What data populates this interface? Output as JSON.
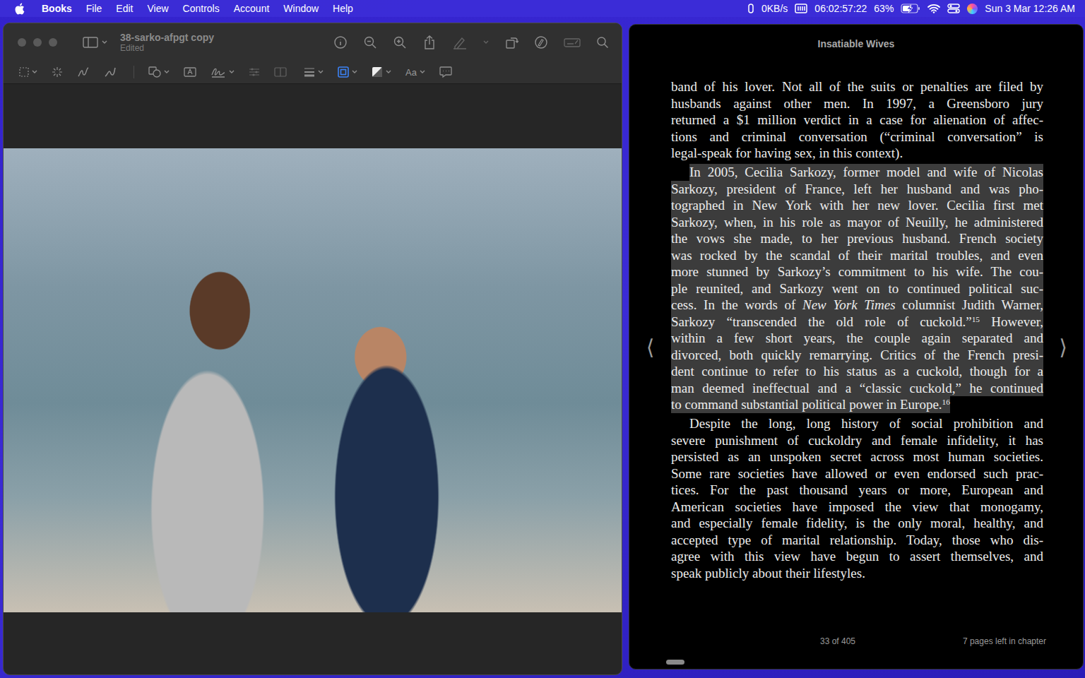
{
  "menubar": {
    "app_menu": "Books",
    "menus": [
      "File",
      "Edit",
      "View",
      "Controls",
      "Account",
      "Window",
      "Help"
    ],
    "status": {
      "network": "0KB/s",
      "timer": "06:02:57:22",
      "battery": "63%",
      "battery_level": 0.63,
      "charging": true,
      "clock": "Sun 3 Mar 12:26 AM"
    }
  },
  "preview": {
    "title": "38-sarko-afpgt copy",
    "subtitle": "Edited",
    "font_button": "Aa"
  },
  "books": {
    "title": "Insatiable Wives",
    "paragraphs": [
      {
        "highlighted": false,
        "lines": [
          "band of his lover. Not all of the suits or penalties are filed by",
          "husbands against other men. In 1997, a Greensboro jury",
          "returned a $1 million verdict in a case for alienation of affec-",
          "tions and criminal conversation (“criminal conversation” is",
          "legal-speak for having sex, in this context)."
        ]
      },
      {
        "highlighted": true,
        "lines": [
          "In 2005, Cecilia Sarkozy, former model and wife of Nicolas",
          "Sarkozy, president of France, left her husband and was pho-",
          "tographed in New York with her new lover. Cecilia first met",
          "Sarkozy, when, in his role as mayor of Neuilly, he administered",
          "the vows she made, to her previous husband. French society",
          "was rocked by the scandal of their marital troubles, and even",
          "more stunned by Sarkozy’s commitment to his wife. The cou-",
          "ple reunited, and Sarkozy went on to continued political suc-",
          [
            {
              "text": "cess. In the words of ",
              "kind": "plain"
            },
            {
              "text": "New York Times",
              "kind": "italic"
            },
            {
              "text": " columnist Judith Warner,",
              "kind": "plain"
            }
          ],
          [
            {
              "text": "Sarkozy “transcended the old role of cuckold.”",
              "kind": "plain"
            },
            {
              "text": "15",
              "kind": "sup"
            },
            {
              "text": " However,",
              "kind": "plain"
            }
          ],
          "within a few short years, the couple again separated and",
          "divorced, both quickly remarrying. Critics of the French presi-",
          "dent continue to refer to his status as a cuckold, though for a",
          "man deemed ineffectual and a “classic cuckold,” he continued",
          [
            {
              "text": "to command substantial political power in Europe.",
              "kind": "plain"
            },
            {
              "text": "16",
              "kind": "sup"
            }
          ]
        ]
      },
      {
        "highlighted": false,
        "lines": [
          "Despite the long, long history of social prohibition and",
          "severe punishment of cuckoldry and female infidelity, it has",
          "persisted as an unspoken secret across most human societies.",
          "Some rare societies have allowed or even endorsed such prac-",
          "tices. For the past thousand years or more, European and",
          "American societies have imposed the view that monogamy,",
          "and especially female fidelity, is the only moral, healthy, and",
          "accepted type of marital relationship. Today, those who dis-",
          "agree with this view have begun to assert themselves, and",
          "speak publicly about their lifestyles."
        ]
      }
    ],
    "nav": {
      "prev": "⟨",
      "next": "⟩"
    },
    "footer": {
      "page": "33 of 405",
      "remaining": "7 pages left in chapter"
    }
  }
}
